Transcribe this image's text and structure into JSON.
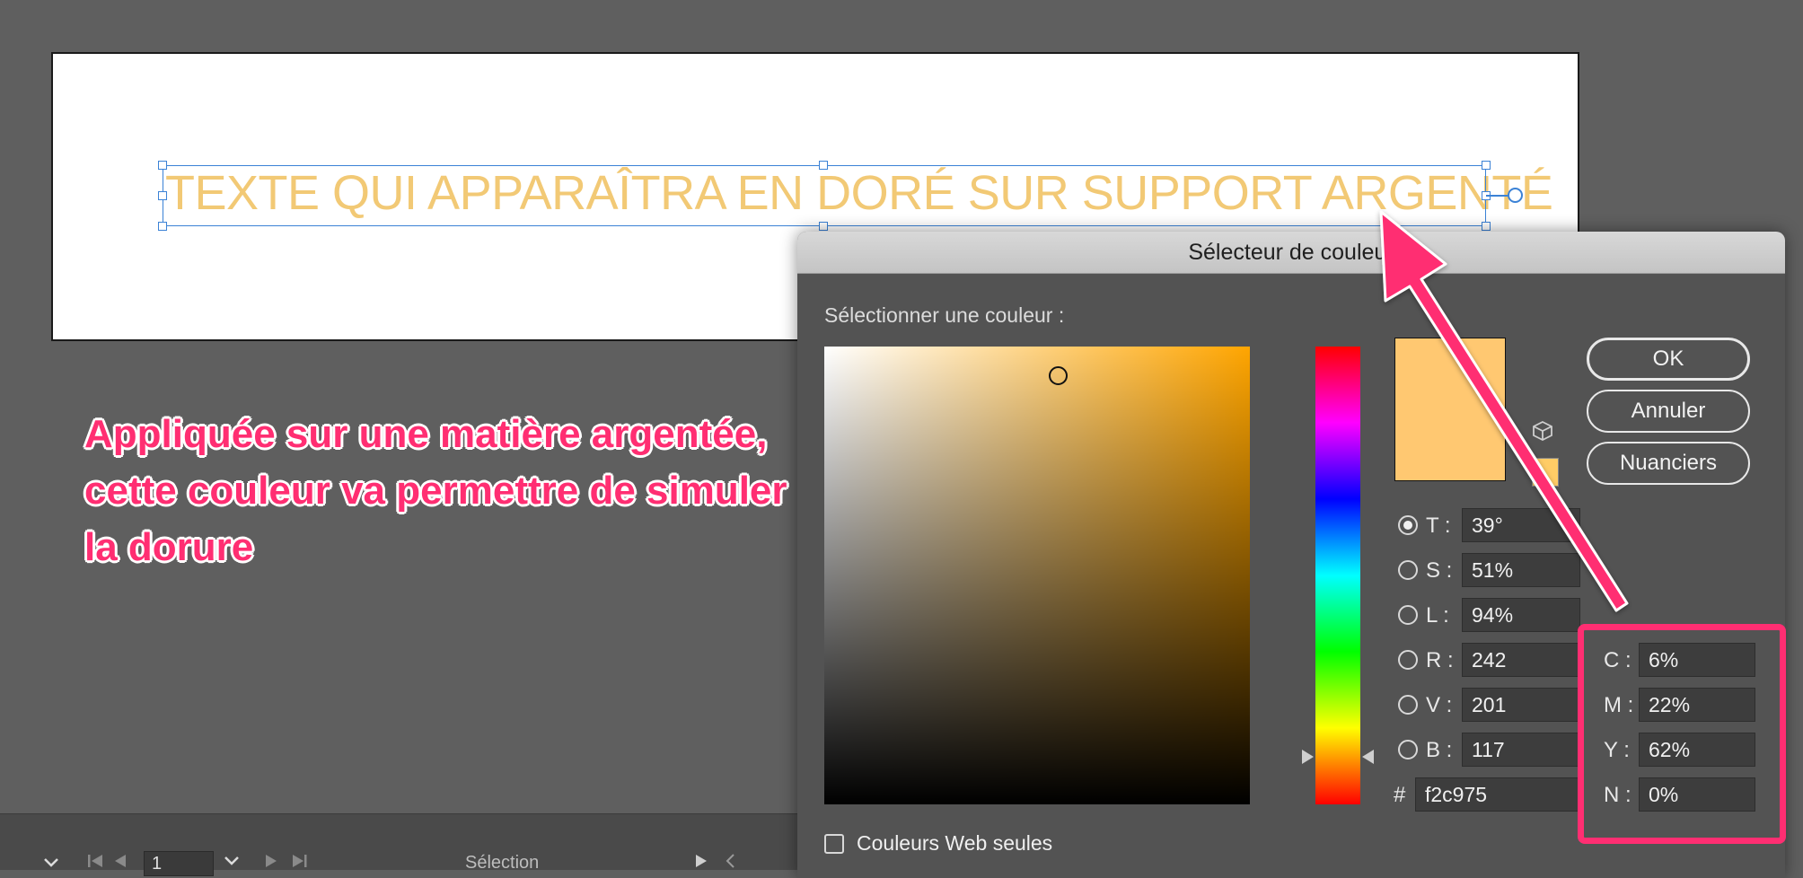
{
  "artboard": {
    "text": "TEXTE QUI APPARAÎTRA EN DORÉ SUR SUPPORT ARGENTÉ",
    "text_color": "#f2c975"
  },
  "annotation": {
    "lines": [
      "Appliquée sur une matière argentée,",
      "cette couleur va permettre de simuler",
      "la dorure"
    ],
    "color": "#ff2e72"
  },
  "bottom_bar": {
    "page_number": "1",
    "status": "Sélection"
  },
  "dialog": {
    "title": "Sélecteur de couleur",
    "prompt": "Sélectionner une couleur :",
    "buttons": {
      "ok": "OK",
      "cancel": "Annuler",
      "swatches": "Nuanciers"
    },
    "current_color": "#ffc871",
    "hsb": {
      "t": {
        "label": "T :",
        "value": "39°"
      },
      "s": {
        "label": "S :",
        "value": "51%"
      },
      "l": {
        "label": "L :",
        "value": "94%"
      }
    },
    "rgb": {
      "r": {
        "label": "R :",
        "value": "242"
      },
      "v": {
        "label": "V :",
        "value": "201"
      },
      "b": {
        "label": "B :",
        "value": "117"
      }
    },
    "hex": {
      "label": "#",
      "value": "f2c975"
    },
    "cmyk": {
      "c": {
        "label": "C :",
        "value": "6%"
      },
      "m": {
        "label": "M :",
        "value": "22%"
      },
      "y": {
        "label": "Y :",
        "value": "62%"
      },
      "n": {
        "label": "N :",
        "value": "0%"
      }
    },
    "web_only_label": "Couleurs Web seules",
    "web_only_checked": false
  },
  "highlight_color": "#ff2e72"
}
